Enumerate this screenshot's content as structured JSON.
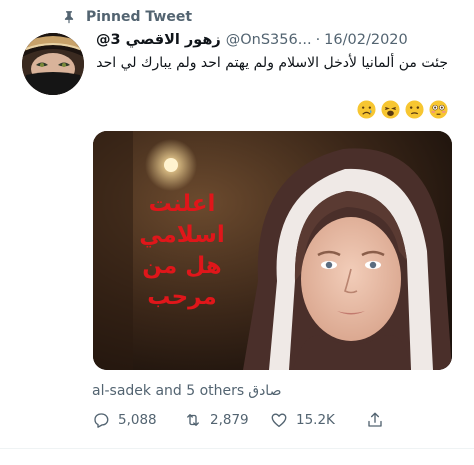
{
  "pinned_label": "Pinned Tweet",
  "tweet": {
    "name": "زهور الاقصي 3@",
    "handle": "@OnS356...",
    "separator": "·",
    "date": "16/02/2020",
    "text": "جئت من ألمانيا لأدخل الاسلام ولم يهتم  احد  ولم يبارك لي احد",
    "emojis": [
      "😢",
      "😩",
      "😕",
      "😳"
    ]
  },
  "media": {
    "overlay_lines": [
      "اعلنت",
      "اسلامي",
      "هل من",
      "مرحب"
    ]
  },
  "likers": {
    "arabic_name": "صادق",
    "text": "al-sadek and 5 others"
  },
  "actions": {
    "replies": "5,088",
    "retweets": "2,879",
    "likes": "15.2K"
  },
  "icons": [
    "pin-icon",
    "reply-icon",
    "retweet-icon",
    "like-icon",
    "share-icon"
  ],
  "colors": {
    "secondary_text": "#536471",
    "overlay_text": "#e0161a"
  }
}
